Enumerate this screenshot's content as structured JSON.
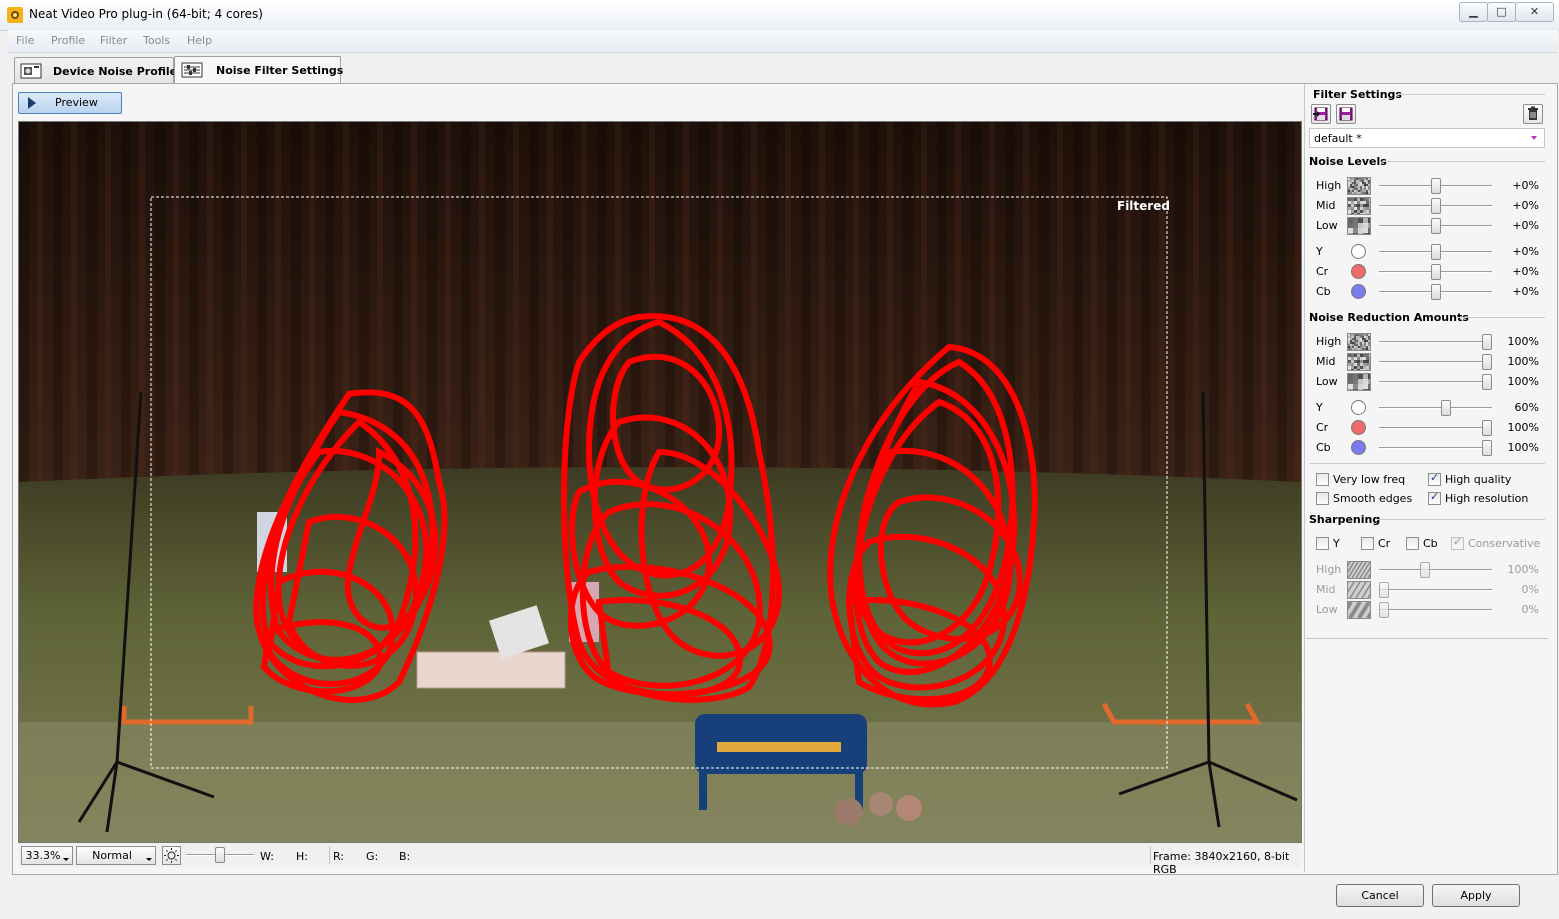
{
  "window": {
    "title": "Neat Video Pro plug-in (64-bit; 4 cores)"
  },
  "menu": [
    "File",
    "Profile",
    "Filter",
    "Tools",
    "Help"
  ],
  "tabs": [
    {
      "label": "Device Noise Profile",
      "active": false
    },
    {
      "label": "Noise Filter Settings",
      "active": true
    }
  ],
  "preview": {
    "button_label": "Preview",
    "overlay_label": "Filtered"
  },
  "statusbar": {
    "zoom": "33.3%",
    "mode": "Normal",
    "w_label": "W:",
    "h_label": "H:",
    "r_label": "R:",
    "g_label": "G:",
    "b_label": "B:",
    "frame_info": "Frame: 3840x2160, 8-bit RGB"
  },
  "filter_settings": {
    "title": "Filter Settings",
    "preset": "default *"
  },
  "noise_levels": {
    "title": "Noise Levels",
    "rows": [
      {
        "label": "High",
        "value": "+0%",
        "level": 0.5
      },
      {
        "label": "Mid",
        "value": "+0%",
        "level": 0.5
      },
      {
        "label": "Low",
        "value": "+0%",
        "level": 0.5
      },
      {
        "label": "Y",
        "value": "+0%",
        "level": 0.5
      },
      {
        "label": "Cr",
        "value": "+0%",
        "level": 0.5
      },
      {
        "label": "Cb",
        "value": "+0%",
        "level": 0.5
      }
    ]
  },
  "noise_reduction": {
    "title": "Noise Reduction Amounts",
    "rows": [
      {
        "label": "High",
        "value": "100%",
        "level": 1.0
      },
      {
        "label": "Mid",
        "value": "100%",
        "level": 1.0
      },
      {
        "label": "Low",
        "value": "100%",
        "level": 1.0
      },
      {
        "label": "Y",
        "value": "60%",
        "level": 0.6
      },
      {
        "label": "Cr",
        "value": "100%",
        "level": 1.0
      },
      {
        "label": "Cb",
        "value": "100%",
        "level": 1.0
      }
    ]
  },
  "options": {
    "very_low_freq": {
      "label": "Very low freq",
      "checked": false
    },
    "high_quality": {
      "label": "High quality",
      "checked": true
    },
    "smooth_edges": {
      "label": "Smooth edges",
      "checked": false
    },
    "high_resolution": {
      "label": "High resolution",
      "checked": true
    }
  },
  "sharpening": {
    "title": "Sharpening",
    "channels": [
      {
        "label": "Y",
        "checked": false
      },
      {
        "label": "Cr",
        "checked": false
      },
      {
        "label": "Cb",
        "checked": false
      }
    ],
    "conservative": {
      "label": "Conservative",
      "checked": true
    },
    "rows": [
      {
        "label": "High",
        "value": "100%",
        "level": 0.4
      },
      {
        "label": "Mid",
        "value": "0%",
        "level": 0.0
      },
      {
        "label": "Low",
        "value": "0%",
        "level": 0.0
      }
    ]
  },
  "footer": {
    "cancel_label": "Cancel",
    "apply_label": "Apply"
  },
  "colors": {
    "cr_dot": "#f06a6a",
    "cb_dot": "#7b7bf0",
    "y_dot": "#ffffff",
    "scribble": "#ff0000"
  }
}
